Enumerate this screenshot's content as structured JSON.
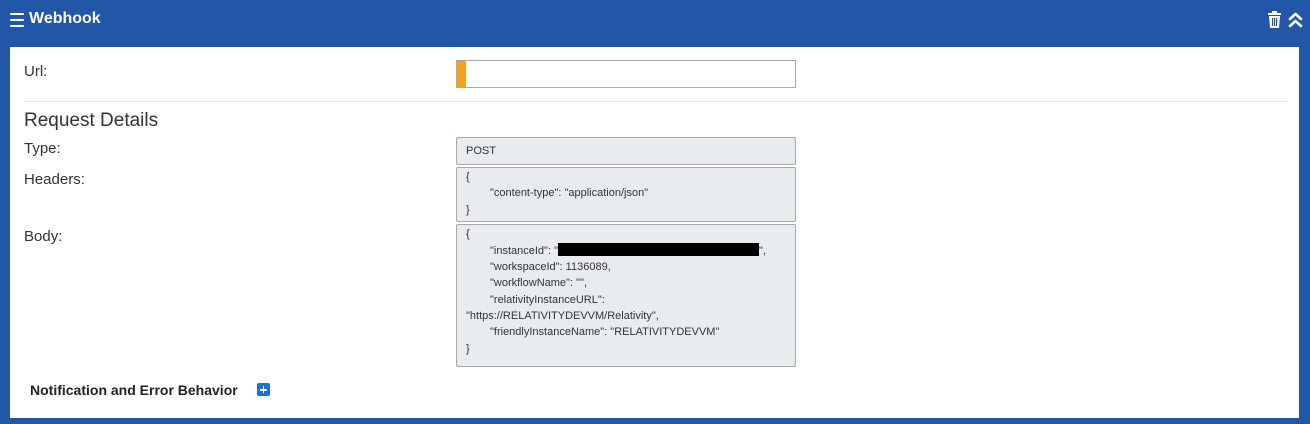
{
  "header": {
    "title": "Webhook",
    "icons": [
      "hamburger-menu-icon",
      "trash-icon",
      "double-chevron-up-icon"
    ]
  },
  "form": {
    "url_label": "Url:",
    "url_value": "",
    "section_title": "Request Details",
    "type_label": "Type:",
    "type_value": "POST",
    "headers_label": "Headers:",
    "headers_lines": [
      "{",
      "\"content-type\": \"application/json\"",
      "}"
    ],
    "body_label": "Body:",
    "body": {
      "open": "{",
      "instance_prefix": "\"instanceId\": \"",
      "instance_suffix": "\",",
      "workspace": "\"workspaceId\": 1136089,",
      "workflow": "\"workflowName\": \"\",",
      "rel_url_key": "\"relativityInstanceURL\":",
      "rel_url_val": "\"https://RELATIVITYDEVVM/Relativity\",",
      "friendly": "\"friendlyInstanceName\": \"RELATIVITYDEVVM\"",
      "close": "}"
    }
  },
  "notification": {
    "label": "Notification and Error Behavior"
  },
  "colors": {
    "header_bg": "#2157a6",
    "required_marker": "#f5a31a",
    "readonly_bg": "#e9ecef",
    "plus_button": "#1a73d9"
  }
}
